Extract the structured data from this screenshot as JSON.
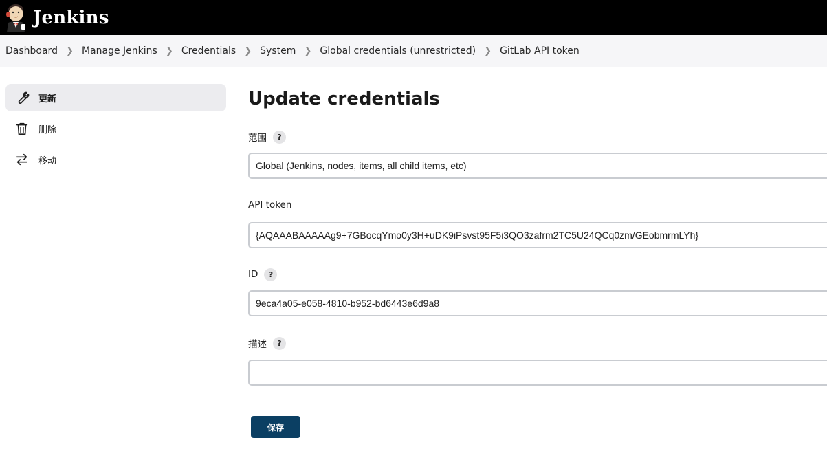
{
  "header": {
    "app_name": "Jenkins",
    "logo_icon": "jenkins-butler-logo"
  },
  "breadcrumb": [
    {
      "label": "Dashboard"
    },
    {
      "label": "Manage Jenkins"
    },
    {
      "label": "Credentials"
    },
    {
      "label": "System"
    },
    {
      "label": "Global credentials (unrestricted)"
    },
    {
      "label": "GitLab API token"
    }
  ],
  "sidebar": {
    "items": [
      {
        "label": "更新",
        "icon": "wrench-icon",
        "active": true
      },
      {
        "label": "删除",
        "icon": "trash-icon",
        "active": false
      },
      {
        "label": "移动",
        "icon": "move-arrows-icon",
        "active": false
      }
    ]
  },
  "main": {
    "title": "Update credentials",
    "scope": {
      "label": "范围",
      "value": "Global (Jenkins, nodes, items, all child items, etc)"
    },
    "api_token": {
      "label": "API token",
      "value": "{AQAAABAAAAAg9+7GBocqYmo0y3H+uDK9iPsvst95F5i3QO3zafrm2TC5U24QCq0zm/GEobmrmLYh}"
    },
    "id": {
      "label": "ID",
      "value": "9eca4a05-e058-4810-b952-bd6443e6d9a8"
    },
    "description": {
      "label": "描述",
      "value": ""
    },
    "help_symbol": "?",
    "save_label": "保存"
  },
  "colors": {
    "header_bg": "#000000",
    "breadcrumb_bg": "#f6f6f8",
    "active_item_bg": "#ececef",
    "save_button_bg": "#0b3f63",
    "input_border": "#c9ccd1"
  }
}
